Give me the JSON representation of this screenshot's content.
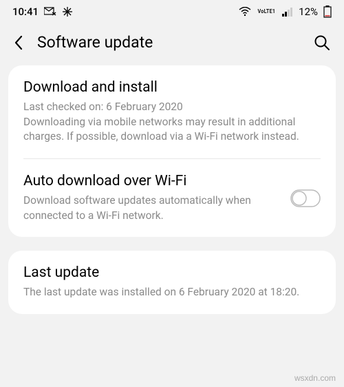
{
  "statusBar": {
    "time": "10:41",
    "batteryPercent": "12%",
    "networkLabel": "VoLTE1"
  },
  "header": {
    "title": "Software update"
  },
  "card1": {
    "download": {
      "title": "Download and install",
      "desc": "Last checked on: 6 February 2020\nDownloading via mobile networks may result in additional charges. If possible, download via a Wi-Fi network instead."
    },
    "auto": {
      "title": "Auto download over Wi-Fi",
      "desc": "Download software updates automatically when connected to a Wi-Fi network."
    }
  },
  "card2": {
    "last": {
      "title": "Last update",
      "desc": "The last update was installed on 6 February 2020 at 18:20."
    }
  },
  "watermark": "wsxdn.com"
}
